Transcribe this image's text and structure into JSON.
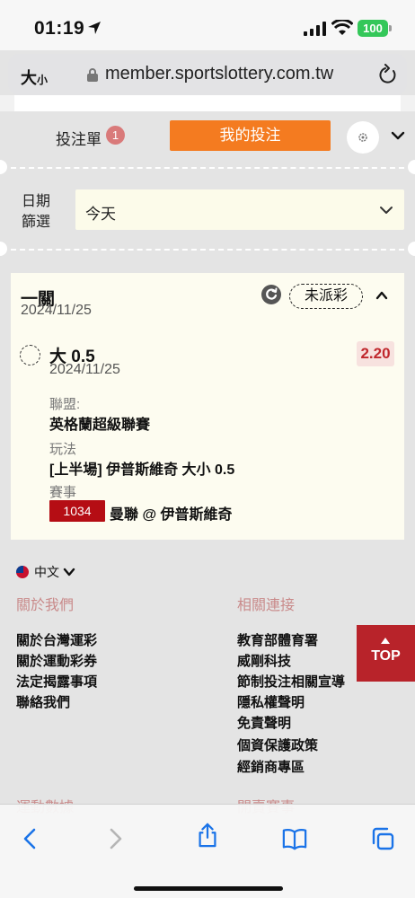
{
  "status": {
    "time": "01:19",
    "battery": "100"
  },
  "browser": {
    "text_size": "大",
    "text_size_small": "小",
    "url": "member.sportslottery.com.tw"
  },
  "slip": {
    "tab_label": "投注單",
    "badge_count": "1",
    "my_bets_label": "我的投注"
  },
  "filter": {
    "label_line1": "日期",
    "label_line2": "篩選",
    "selected": "今天"
  },
  "bet": {
    "type": "一關",
    "date": "2024/11/25",
    "status": "未派彩",
    "selection": {
      "name": "大 0.5",
      "date": "2024/11/25",
      "odds": "2.20",
      "league_label": "聯盟:",
      "league": "英格蘭超級聯賽",
      "market_label": "玩法",
      "market": "[上半場] 伊普斯維奇 大小 0.5",
      "event_label": "賽事",
      "match_no": "1034",
      "match": "曼聯 @ 伊普斯維奇"
    }
  },
  "footer": {
    "language": "中文",
    "about_title": "關於我們",
    "about_links": [
      "關於台灣運彩",
      "關於運動彩券",
      "法定揭露事項",
      "聯絡我們"
    ],
    "related_title": "相關連接",
    "related_links": [
      "教育部體育署",
      "威剛科技",
      "節制投注相關宣導",
      "隱私權聲明",
      "免責聲明",
      "個資保護政策",
      "經銷商專區"
    ],
    "sports_title": "運動數據",
    "events_title": "開賣賽事",
    "top_label": "TOP"
  }
}
